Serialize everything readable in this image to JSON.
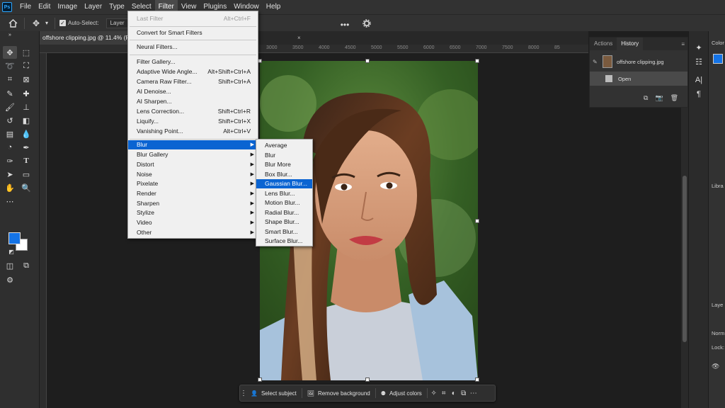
{
  "menubar": {
    "app_logo": "Ps",
    "items": [
      "File",
      "Edit",
      "Image",
      "Layer",
      "Type",
      "Select",
      "Filter",
      "View",
      "Plugins",
      "Window",
      "Help"
    ]
  },
  "options": {
    "auto_select_label": "Auto-Select:",
    "auto_select_value": "Layer"
  },
  "tabs": {
    "doc_title": "offshore clipping.jpg @ 11.4% (R",
    "second_tab": "",
    "second_tab_close": "×"
  },
  "ruler": {
    "ticks": [
      "3000",
      "3500",
      "4000",
      "4500",
      "5000",
      "5500",
      "6000",
      "6500",
      "7000",
      "7500",
      "8000",
      "85"
    ]
  },
  "filter_menu": {
    "last_filter": {
      "label": "Last Filter",
      "shortcut": "Alt+Ctrl+F"
    },
    "convert_smart": "Convert for Smart Filters",
    "neural": "Neural Filters...",
    "items": [
      {
        "label": "Filter Gallery...",
        "shortcut": ""
      },
      {
        "label": "Adaptive Wide Angle...",
        "shortcut": "Alt+Shift+Ctrl+A"
      },
      {
        "label": "Camera Raw Filter...",
        "shortcut": "Shift+Ctrl+A"
      },
      {
        "label": "AI Denoise...",
        "shortcut": ""
      },
      {
        "label": "AI Sharpen...",
        "shortcut": ""
      },
      {
        "label": "Lens Correction...",
        "shortcut": "Shift+Ctrl+R"
      },
      {
        "label": "Liquify...",
        "shortcut": "Shift+Ctrl+X"
      },
      {
        "label": "Vanishing Point...",
        "shortcut": "Alt+Ctrl+V"
      }
    ],
    "submenus": [
      "Blur",
      "Blur Gallery",
      "Distort",
      "Noise",
      "Pixelate",
      "Render",
      "Sharpen",
      "Stylize",
      "Video",
      "Other"
    ]
  },
  "blur_menu": {
    "items": [
      "Average",
      "Blur",
      "Blur More",
      "Box Blur...",
      "Gaussian Blur...",
      "Lens Blur...",
      "Motion Blur...",
      "Radial Blur...",
      "Shape Blur...",
      "Smart Blur...",
      "Surface Blur..."
    ],
    "highlighted": "Gaussian Blur..."
  },
  "history_panel": {
    "tabs": [
      "Actions",
      "History"
    ],
    "snapshot": "offshore clipping.jpg",
    "state": "Open"
  },
  "right_panel": {
    "color_tab": "Color",
    "libraries_tab": "Libra",
    "layers_tab": "Laye",
    "blend_mode": "Norm",
    "lock_label": "Lock:"
  },
  "taskbar": {
    "select_subject": "Select subject",
    "remove_background": "Remove background",
    "adjust_colors": "Adjust colors"
  },
  "colors": {
    "foreground": "#1473e6",
    "background": "#ffffff",
    "menu_highlight": "#0a64d2"
  }
}
